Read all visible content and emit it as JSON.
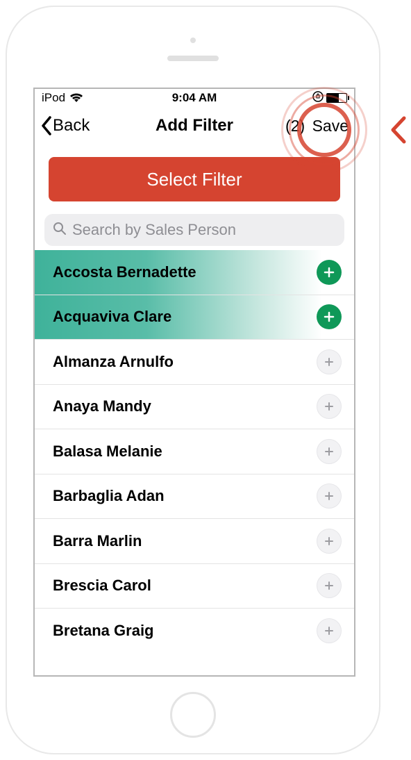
{
  "status": {
    "device": "iPod",
    "time": "9:04 AM",
    "battery_level_pct": 60
  },
  "nav": {
    "back_label": "Back",
    "title": "Add Filter",
    "count_label": "(2)",
    "save_label": "Save"
  },
  "select_filter_label": "Select Filter",
  "search": {
    "placeholder": "Search by Sales Person",
    "value": ""
  },
  "people": [
    {
      "name": "Accosta Bernadette",
      "selected": true
    },
    {
      "name": "Acquaviva Clare",
      "selected": true
    },
    {
      "name": "Almanza Arnulfo",
      "selected": false
    },
    {
      "name": "Anaya Mandy",
      "selected": false
    },
    {
      "name": "Balasa Melanie",
      "selected": false
    },
    {
      "name": "Barbaglia Adan",
      "selected": false
    },
    {
      "name": "Barra Marlin",
      "selected": false
    },
    {
      "name": "Brescia Carol",
      "selected": false
    },
    {
      "name": "Bretana Graig",
      "selected": false
    }
  ],
  "colors": {
    "primary_red": "#d54430",
    "selected_green": "#0f9858",
    "selected_row_teal": "#3fb29a"
  }
}
